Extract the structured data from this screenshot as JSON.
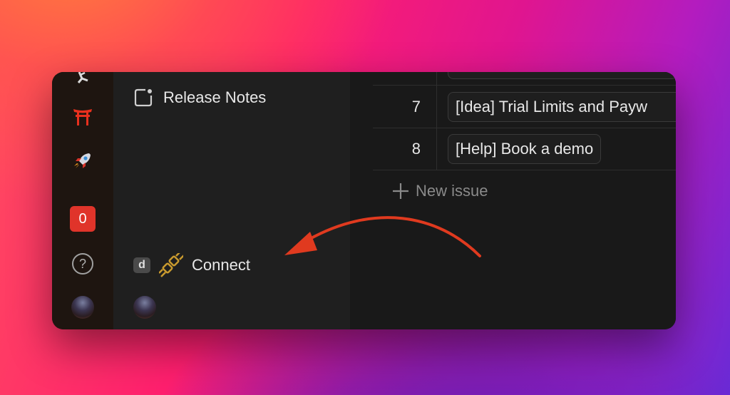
{
  "sidebar": {
    "release_notes_label": "Release Notes",
    "connect_shortcut": "d",
    "connect_label": "Connect"
  },
  "rail": {
    "notification_count": "0",
    "help_symbol": "?"
  },
  "issues": {
    "rows": [
      {
        "number": "7",
        "title": "[Idea] Trial Limits and Payw"
      },
      {
        "number": "8",
        "title": "[Help] Book a demo"
      }
    ],
    "new_issue_label": "New issue"
  },
  "annotation": {
    "arrow_color": "#e03a1f"
  }
}
